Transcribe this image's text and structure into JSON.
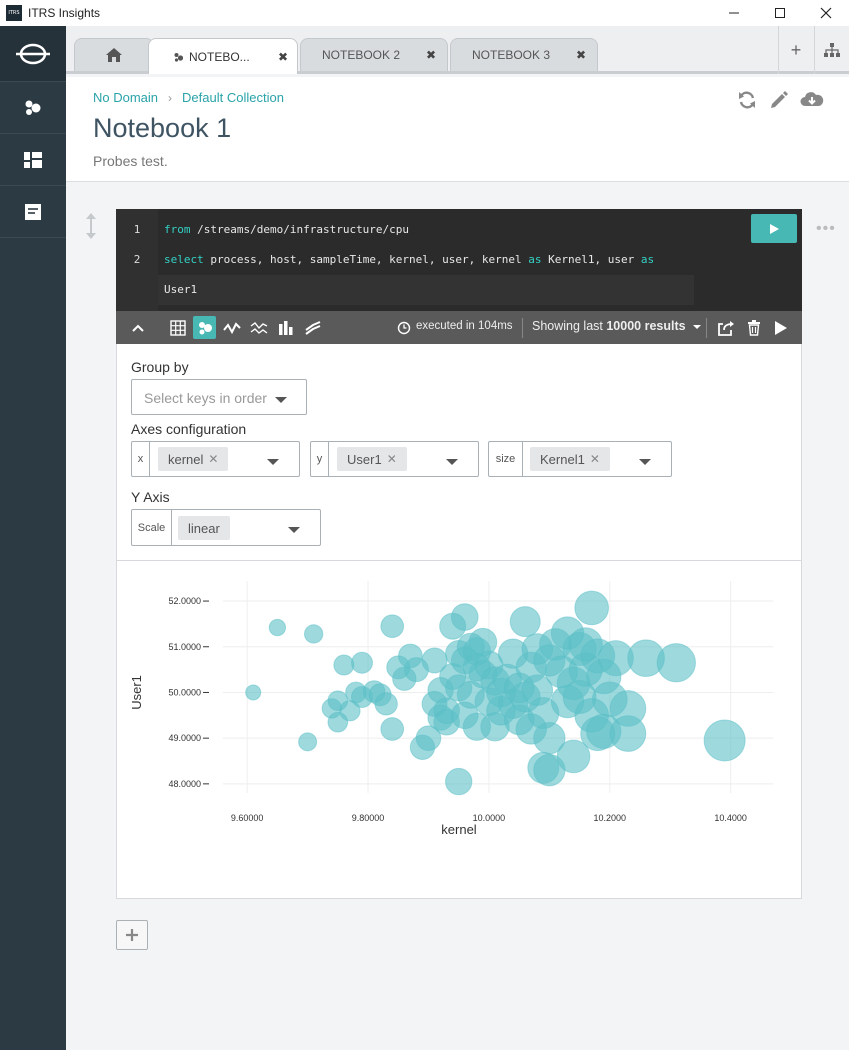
{
  "window": {
    "app_logo_text": "ITRS",
    "title": "ITRS Insights",
    "minimize": "—",
    "maximize": "☐",
    "close": "✕"
  },
  "sidebar": {
    "items": [
      {
        "icon": "logo-icon"
      },
      {
        "icon": "dots-icon"
      },
      {
        "icon": "dashboard-icon"
      },
      {
        "icon": "notebook-icon"
      }
    ]
  },
  "tabs": {
    "home_icon": "home-icon",
    "items": [
      {
        "label": "NOTEBO...",
        "close": "✖",
        "active": true
      },
      {
        "label": "NOTEBOOK 2",
        "close": "✖",
        "active": false
      },
      {
        "label": "NOTEBOOK 3",
        "close": "✖",
        "active": false
      }
    ],
    "add_label": "+"
  },
  "header": {
    "breadcrumb": [
      "No Domain",
      "Default Collection"
    ],
    "breadcrumb_sep": "›",
    "title": "Notebook 1",
    "description": "Probes test."
  },
  "editor": {
    "lines": [
      {
        "num": "1",
        "parts": [
          {
            "t": "from",
            "kw": true
          },
          {
            "t": " /streams/demo/infrastructure/cpu",
            "kw": false
          }
        ]
      },
      {
        "num": "2",
        "parts": [
          {
            "t": "select",
            "kw": true
          },
          {
            "t": " process, host, sampleTime, kernel, user, kernel ",
            "kw": false
          },
          {
            "t": "as",
            "kw": true
          },
          {
            "t": " Kernel1, user ",
            "kw": false
          },
          {
            "t": "as",
            "kw": true
          }
        ]
      },
      {
        "num": "",
        "parts": [
          {
            "t": "User1",
            "kw": false
          }
        ]
      }
    ],
    "cell_menu": "•••"
  },
  "toolbar": {
    "executed_prefix": "executed in",
    "executed_value": "104ms",
    "showing_prefix": "Showing last",
    "showing_count": "10000 results"
  },
  "config": {
    "group_by_label": "Group by",
    "group_by_placeholder": "Select keys in order",
    "axes_label": "Axes configuration",
    "axes": [
      {
        "prefix": "x",
        "value": "kernel"
      },
      {
        "prefix": "y",
        "value": "User1"
      },
      {
        "prefix": "size",
        "value": "Kernel1"
      }
    ],
    "chip_remove": "✕",
    "y_axis_label": "Y Axis",
    "scale_prefix": "Scale",
    "scale_value": "linear"
  },
  "chart_data": {
    "type": "scatter",
    "title": "",
    "xlabel": "kernel",
    "ylabel": "User1",
    "xlim": [
      9.56,
      10.47
    ],
    "ylim": [
      47.8,
      52.22
    ],
    "xticks": [
      "9.60000",
      "9.80000",
      "10.0000",
      "10.2000",
      "10.4000"
    ],
    "xtick_values": [
      9.6,
      9.8,
      10.0,
      10.2,
      10.4
    ],
    "yticks": [
      "48.0000",
      "49.0000",
      "50.0000",
      "51.0000",
      "52.0000"
    ],
    "ytick_values": [
      48,
      49,
      50,
      51,
      52
    ],
    "grid": true,
    "color": "#5bbfc7",
    "size_field": "Kernel1",
    "points": [
      [
        9.61,
        50.0,
        9.61
      ],
      [
        9.65,
        51.42,
        9.65
      ],
      [
        9.7,
        48.92,
        9.7
      ],
      [
        9.71,
        51.28,
        9.71
      ],
      [
        9.74,
        49.65,
        9.74
      ],
      [
        9.75,
        49.82,
        9.75
      ],
      [
        9.75,
        49.35,
        9.75
      ],
      [
        9.76,
        50.6,
        9.76
      ],
      [
        9.77,
        49.6,
        9.77
      ],
      [
        9.78,
        50.0,
        9.78
      ],
      [
        9.79,
        49.9,
        9.79
      ],
      [
        9.79,
        50.65,
        9.79
      ],
      [
        9.81,
        50.02,
        9.81
      ],
      [
        9.82,
        49.95,
        9.82
      ],
      [
        9.83,
        49.75,
        9.83
      ],
      [
        9.84,
        49.2,
        9.84
      ],
      [
        9.84,
        51.45,
        9.84
      ],
      [
        9.85,
        50.55,
        9.85
      ],
      [
        9.86,
        50.3,
        9.86
      ],
      [
        9.87,
        50.8,
        9.87
      ],
      [
        9.88,
        50.5,
        9.88
      ],
      [
        9.89,
        48.8,
        9.89
      ],
      [
        9.9,
        49.0,
        9.9
      ],
      [
        9.91,
        50.7,
        9.91
      ],
      [
        9.91,
        49.75,
        9.91
      ],
      [
        9.92,
        50.05,
        9.92
      ],
      [
        9.92,
        49.45,
        9.92
      ],
      [
        9.93,
        49.6,
        9.93
      ],
      [
        9.93,
        49.35,
        9.93
      ],
      [
        9.94,
        51.45,
        9.94
      ],
      [
        9.94,
        50.35,
        9.94
      ],
      [
        9.95,
        50.85,
        9.95
      ],
      [
        9.95,
        48.05,
        9.95
      ],
      [
        9.95,
        50.1,
        9.95
      ],
      [
        9.96,
        51.65,
        9.96
      ],
      [
        9.96,
        49.5,
        9.96
      ],
      [
        9.96,
        50.7,
        9.96
      ],
      [
        9.97,
        51.0,
        9.97
      ],
      [
        9.97,
        49.95,
        9.97
      ],
      [
        9.98,
        50.55,
        9.98
      ],
      [
        9.98,
        49.25,
        9.98
      ],
      [
        9.98,
        50.9,
        9.98
      ],
      [
        9.99,
        50.4,
        9.99
      ],
      [
        9.99,
        51.1,
        9.99
      ],
      [
        10.0,
        50.6,
        10.0
      ],
      [
        10.0,
        49.8,
        10.0
      ],
      [
        10.01,
        50.25,
        10.01
      ],
      [
        10.01,
        49.25,
        10.01
      ],
      [
        10.02,
        50.0,
        10.02
      ],
      [
        10.02,
        49.6,
        10.02
      ],
      [
        10.03,
        50.3,
        10.03
      ],
      [
        10.04,
        49.75,
        10.04
      ],
      [
        10.04,
        50.85,
        10.04
      ],
      [
        10.05,
        49.4,
        10.05
      ],
      [
        10.05,
        50.1,
        10.05
      ],
      [
        10.06,
        51.55,
        10.06
      ],
      [
        10.06,
        49.9,
        10.06
      ],
      [
        10.07,
        50.55,
        10.07
      ],
      [
        10.07,
        49.2,
        10.07
      ],
      [
        10.08,
        50.95,
        10.08
      ],
      [
        10.08,
        50.05,
        10.08
      ],
      [
        10.09,
        49.55,
        10.09
      ],
      [
        10.09,
        48.35,
        10.09
      ],
      [
        10.1,
        50.7,
        10.1
      ],
      [
        10.1,
        48.3,
        10.1
      ],
      [
        10.1,
        49.0,
        10.1
      ],
      [
        10.11,
        51.05,
        10.11
      ],
      [
        10.12,
        50.45,
        10.12
      ],
      [
        10.13,
        49.8,
        10.13
      ],
      [
        10.13,
        51.3,
        10.13
      ],
      [
        10.14,
        50.2,
        10.14
      ],
      [
        10.14,
        48.6,
        10.14
      ],
      [
        10.15,
        50.95,
        10.15
      ],
      [
        10.15,
        49.9,
        10.15
      ],
      [
        10.16,
        50.5,
        10.16
      ],
      [
        10.16,
        51.05,
        10.16
      ],
      [
        10.17,
        49.5,
        10.17
      ],
      [
        10.17,
        51.85,
        10.17
      ],
      [
        10.18,
        50.8,
        10.18
      ],
      [
        10.18,
        49.1,
        10.18
      ],
      [
        10.19,
        50.35,
        10.19
      ],
      [
        10.19,
        49.15,
        10.19
      ],
      [
        10.2,
        49.85,
        10.2
      ],
      [
        10.21,
        50.75,
        10.21
      ],
      [
        10.23,
        49.65,
        10.23
      ],
      [
        10.23,
        49.1,
        10.23
      ],
      [
        10.26,
        50.75,
        10.26
      ],
      [
        10.31,
        50.65,
        10.31
      ],
      [
        10.39,
        48.95,
        10.39
      ]
    ]
  }
}
